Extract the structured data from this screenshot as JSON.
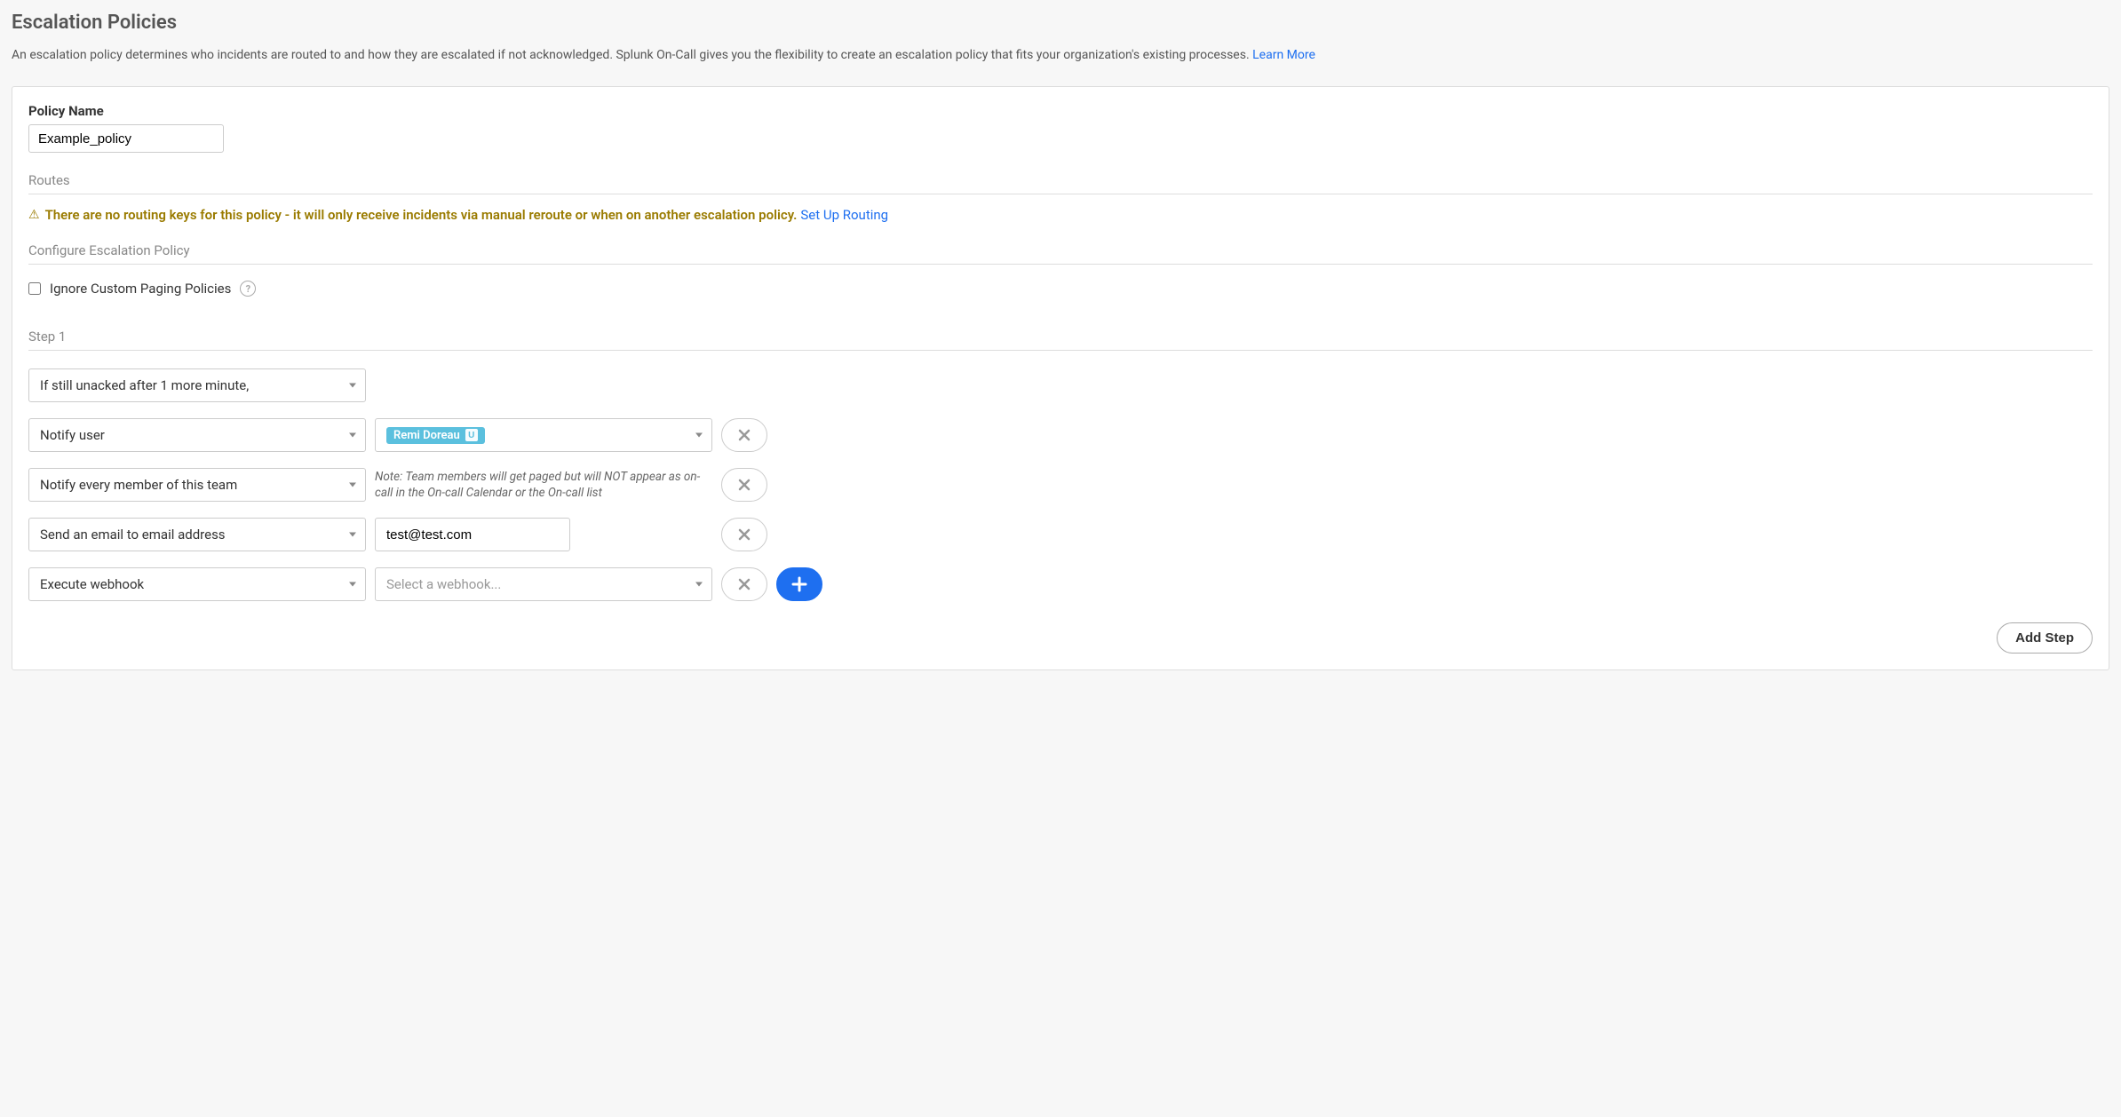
{
  "page": {
    "title": "Escalation Policies",
    "intro_text": "An escalation policy determines who incidents are routed to and how they are escalated if not acknowledged. Splunk On-Call gives you the flexibility to create an escalation policy that fits your organization's existing processes. ",
    "learn_more": "Learn More"
  },
  "policy": {
    "name_label": "Policy Name",
    "name_value": "Example_policy"
  },
  "routes": {
    "header": "Routes",
    "warning_text": "There are no routing keys for this policy - it will only receive incidents via manual reroute or when on another escalation policy.",
    "setup_link": "Set Up Routing"
  },
  "configure": {
    "header": "Configure Escalation Policy",
    "ignore_label": "Ignore Custom Paging Policies"
  },
  "step": {
    "header": "Step 1",
    "delay_select": "If still unacked after 1 more minute,",
    "actions": [
      {
        "type_label": "Notify user",
        "user_name": "Remi Doreau",
        "user_badge": "U"
      },
      {
        "type_label": "Notify every member of this team",
        "note": "Note: Team members will get paged but will NOT appear as on-call in the On-call Calendar or the On-call list"
      },
      {
        "type_label": "Send an email to email address",
        "email_value": "test@test.com"
      },
      {
        "type_label": "Execute webhook",
        "webhook_placeholder": "Select a webhook..."
      }
    ]
  },
  "buttons": {
    "add_step": "Add Step"
  }
}
